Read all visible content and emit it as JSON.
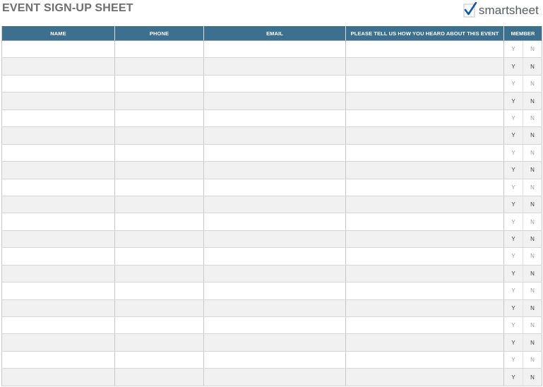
{
  "header": {
    "title": "EVENT SIGN-UP SHEET",
    "logo": {
      "icon": "checkmark-logo-icon",
      "text_light": "smart",
      "text_dark": "sheet"
    }
  },
  "table": {
    "columns": [
      "NAME",
      "PHONE",
      "EMAIL",
      "PLEASE TELL US HOW YOU HEARD ABOUT THIS EVENT",
      "MEMBER"
    ],
    "member_options": [
      "Y",
      "N"
    ],
    "row_count": 20
  },
  "colors": {
    "header_bg": "#3d6f8f",
    "title": "#6e6e6e",
    "stripe": "#f1f1f1"
  }
}
